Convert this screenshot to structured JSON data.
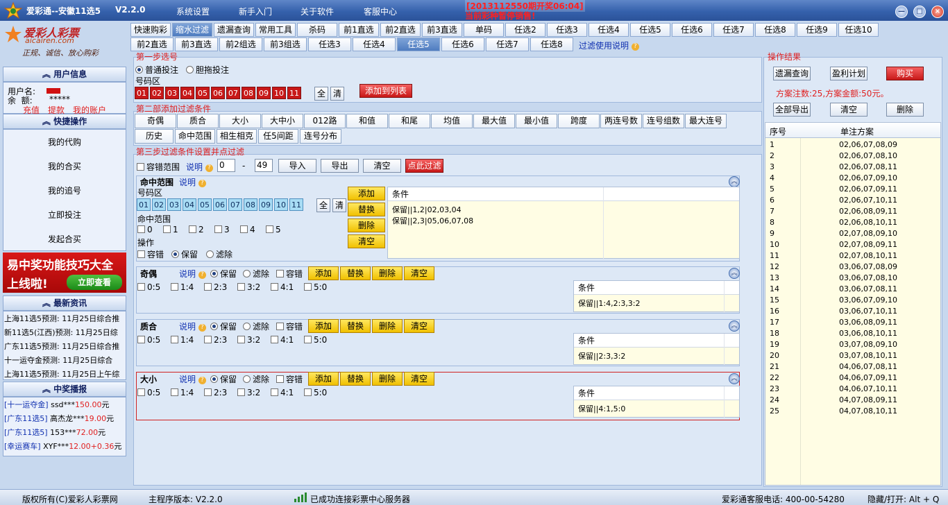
{
  "titlebar": {
    "title": "爱彩通--安徽11选5",
    "version": "V2.2.0",
    "menu": [
      "系统设置",
      "新手入门",
      "关于软件",
      "客服中心"
    ],
    "draw_notice": "[2013112550期开奖06:04]",
    "stop_notice": "当前彩种暂停销售!"
  },
  "brand": {
    "name": "爱彩人彩票",
    "url": "aicairen.com",
    "slogan": "正规、诚信、放心购彩"
  },
  "user": {
    "heading": "用户信息",
    "name_label": "用户名:",
    "name_value": "--------",
    "balance_label": "余  额:",
    "balance_value": "*****",
    "links": [
      "充值",
      "提款",
      "我的账户"
    ]
  },
  "quick": {
    "heading": "快捷操作",
    "items": [
      "我的代购",
      "我的合买",
      "我的追号",
      "立即投注",
      "发起合买"
    ]
  },
  "promo": {
    "line1": "易中奖功能技巧大全",
    "line2": "上线啦!",
    "button": "立即查看"
  },
  "news": {
    "heading": "最新资讯",
    "items": [
      "上海11选5预测: 11月25日综合推",
      "新11选5(江西)预测: 11月25日综",
      "广东11选5预测: 11月25日综合推",
      "十一运夺金预测: 11月25日综合",
      "上海11选5预测: 11月25日上午综"
    ]
  },
  "winners": {
    "heading": "中奖播报",
    "items": [
      {
        "game": "[十一运夺金]",
        "user": "ssd***",
        "amount": "150.00",
        "unit": "元"
      },
      {
        "game": "[广东11选5]",
        "user": "高杰龙***",
        "amount": "19.00",
        "unit": "元"
      },
      {
        "game": "[广东11选5]",
        "user": "153***",
        "amount": "72.00",
        "unit": "元"
      },
      {
        "game": "[幸运赛车]",
        "user": "XYF***",
        "amount": "12.00+0.36",
        "unit": "元"
      }
    ]
  },
  "tabs1": [
    "快速购彩",
    "缩水过滤",
    "遗漏查询",
    "常用工具",
    "杀码",
    "前1直选",
    "前2直选",
    "前3直选",
    "单码",
    "任选2",
    "任选3",
    "任选4",
    "任选5",
    "任选6",
    "任选7",
    "任选8",
    "任选9",
    "任选10"
  ],
  "tabs2": [
    "前2直选",
    "前3直选",
    "前2组选",
    "前3组选",
    "任选3",
    "任选4",
    "任选5",
    "任选6",
    "任选7",
    "任选8"
  ],
  "filter_help": "过滤使用说明",
  "step1": {
    "title": "第一步选号",
    "mode_normal": "普通投注",
    "mode_dan": "胆拖投注",
    "zone_label": "号码区",
    "numbers": [
      "01",
      "02",
      "03",
      "04",
      "05",
      "06",
      "07",
      "08",
      "09",
      "10",
      "11"
    ],
    "all": "全",
    "clear": "清",
    "add_to_list": "添加到列表"
  },
  "step2": {
    "title": "第二部添加过滤条件",
    "row1": [
      "奇偶",
      "质合",
      "大小",
      "大中小",
      "012路",
      "和值",
      "和尾",
      "均值",
      "最大值",
      "最小值",
      "跨度",
      "两连号数",
      "连号组数",
      "最大连号"
    ],
    "row2": [
      "历史",
      "命中范围",
      "相生相克",
      "任5间距",
      "连号分布"
    ]
  },
  "step3": {
    "title": "第三步过滤条件设置并点过滤",
    "tolerance": "容错范围",
    "help": "说明",
    "range_from": "0",
    "range_to": "49",
    "dash": "-",
    "import": "导入",
    "export": "导出",
    "clear": "清空",
    "filter": "点此过滤"
  },
  "hit": {
    "title": "命中范围",
    "help": "说明",
    "zone_label": "号码区",
    "numbers": [
      "01",
      "02",
      "03",
      "04",
      "05",
      "06",
      "07",
      "08",
      "09",
      "10",
      "11"
    ],
    "all": "全",
    "clear": "清",
    "range_label": "命中范围",
    "range_opts": [
      "0",
      "1",
      "2",
      "3",
      "4",
      "5"
    ],
    "op_label": "操作",
    "op_tol": "容错",
    "op_keep": "保留",
    "op_filter": "滤除",
    "btn_add": "添加",
    "btn_replace": "替换",
    "btn_delete": "删除",
    "btn_clear": "清空",
    "cond_head": "条件",
    "conds": [
      "保留||1,2|02,03,04",
      "保留||2,3|05,06,07,08"
    ]
  },
  "panels": [
    {
      "title": "奇偶",
      "cond": "保留||1:4,2:3,3:2"
    },
    {
      "title": "质合",
      "cond": "保留||2:3,3:2"
    },
    {
      "title": "大小",
      "cond": "保留||4:1,5:0"
    }
  ],
  "panel_common": {
    "help": "说明",
    "keep": "保留",
    "filter": "滤除",
    "tol": "容错",
    "add": "添加",
    "replace": "替换",
    "delete": "删除",
    "clear": "清空",
    "ratios": [
      "0:5",
      "1:4",
      "2:3",
      "3:2",
      "4:1",
      "5:0"
    ],
    "cond_head": "条件"
  },
  "result": {
    "title": "操作结果",
    "btn_miss": "遗漏查询",
    "btn_plan": "盈利计划",
    "btn_buy": "购买",
    "summary": "方案注数:25,方案金额:50元。",
    "btn_export": "全部导出",
    "btn_clear": "清空",
    "btn_delete": "删除",
    "col_no": "序号",
    "col_plan": "单注方案",
    "rows": [
      [
        "1",
        "02,06,07,08,09"
      ],
      [
        "2",
        "02,06,07,08,10"
      ],
      [
        "3",
        "02,06,07,08,11"
      ],
      [
        "4",
        "02,06,07,09,10"
      ],
      [
        "5",
        "02,06,07,09,11"
      ],
      [
        "6",
        "02,06,07,10,11"
      ],
      [
        "7",
        "02,06,08,09,11"
      ],
      [
        "8",
        "02,06,08,10,11"
      ],
      [
        "9",
        "02,07,08,09,10"
      ],
      [
        "10",
        "02,07,08,09,11"
      ],
      [
        "11",
        "02,07,08,10,11"
      ],
      [
        "12",
        "03,06,07,08,09"
      ],
      [
        "13",
        "03,06,07,08,10"
      ],
      [
        "14",
        "03,06,07,08,11"
      ],
      [
        "15",
        "03,06,07,09,10"
      ],
      [
        "16",
        "03,06,07,10,11"
      ],
      [
        "17",
        "03,06,08,09,11"
      ],
      [
        "18",
        "03,06,08,10,11"
      ],
      [
        "19",
        "03,07,08,09,10"
      ],
      [
        "20",
        "03,07,08,10,11"
      ],
      [
        "21",
        "04,06,07,08,11"
      ],
      [
        "22",
        "04,06,07,09,11"
      ],
      [
        "23",
        "04,06,07,10,11"
      ],
      [
        "24",
        "04,07,08,09,11"
      ],
      [
        "25",
        "04,07,08,10,11"
      ]
    ]
  },
  "status": {
    "copyright": "版权所有(C)爱彩人彩票网",
    "version": "主程序版本: V2.2.0",
    "conn": "已成功连接彩票中心服务器",
    "phone": "爱彩通客服电话: 400-00-54280",
    "hotkey": "隐藏/打开: Alt + Q"
  },
  "colors": {
    "accent": "#3561ac",
    "red": "#c81818",
    "yellow": "#f0c000",
    "cond_bg": "#fffde4"
  }
}
